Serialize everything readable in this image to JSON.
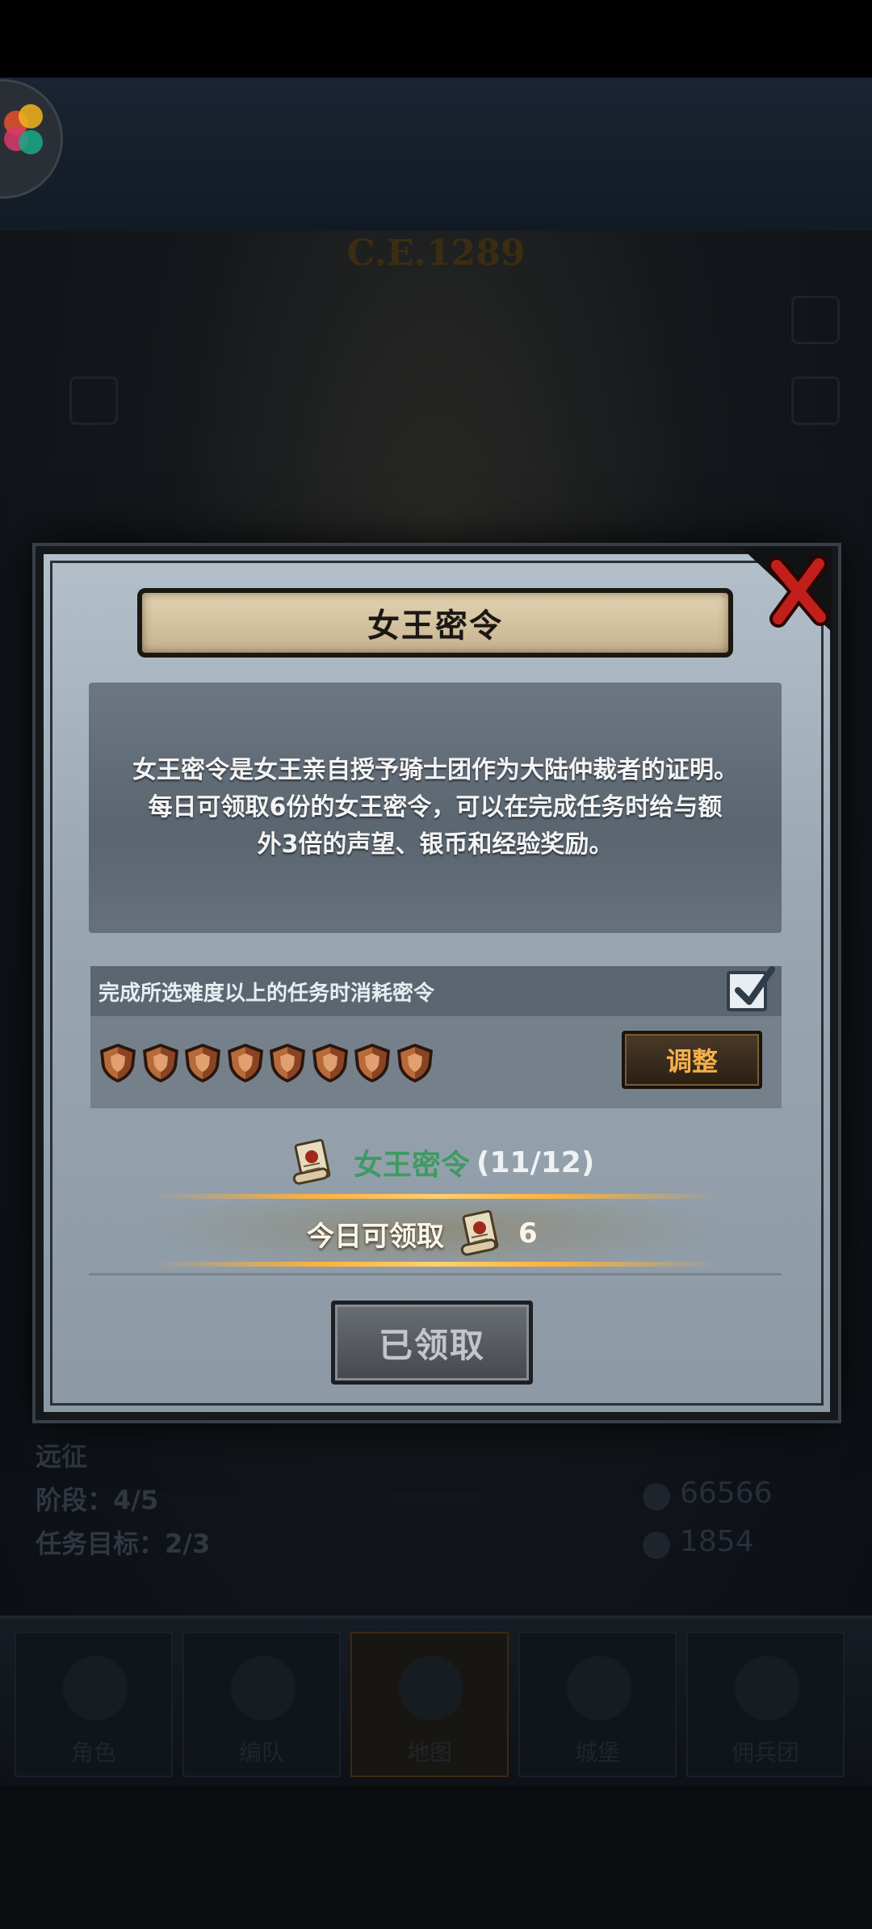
{
  "background": {
    "era_label": "C.E.1289",
    "stats": {
      "mode_label": "远征",
      "stage_label": "阶段：",
      "stage_value": "4/5",
      "goal_label": "任务目标：",
      "goal_value": "2/3",
      "silver": "66566",
      "other": "1854"
    },
    "nav": [
      {
        "label": "角色",
        "icon": "character-icon"
      },
      {
        "label": "编队",
        "icon": "team-icon"
      },
      {
        "label": "地图",
        "icon": "map-compass-icon"
      },
      {
        "label": "城堡",
        "icon": "castle-icon"
      },
      {
        "label": "佣兵团",
        "icon": "mercenary-icon"
      }
    ]
  },
  "dialog": {
    "title": "女王密令",
    "description": "女王密令是女王亲自授予骑士团作为大陆仲裁者的证明。\n每日可领取6份的女王密令，可以在完成任务时给与额\n外3倍的声望、银币和经验奖励。",
    "option": {
      "label": "完成所选难度以上的任务时消耗密令",
      "checked": true
    },
    "shield_count": 8,
    "adjust_label": "调整",
    "order": {
      "name": "女王密令",
      "count": "(11/12)"
    },
    "claim": {
      "label": "今日可领取",
      "value": "6"
    },
    "claimed_button": "已领取"
  },
  "colors": {
    "panel": "#9aa7b2",
    "title_plaque": "#d6c4a0",
    "order_green": "#3f9a62",
    "adjust_orange": "#f3b04c",
    "close_red": "#c21f1a",
    "glow": "#ffb23a"
  }
}
